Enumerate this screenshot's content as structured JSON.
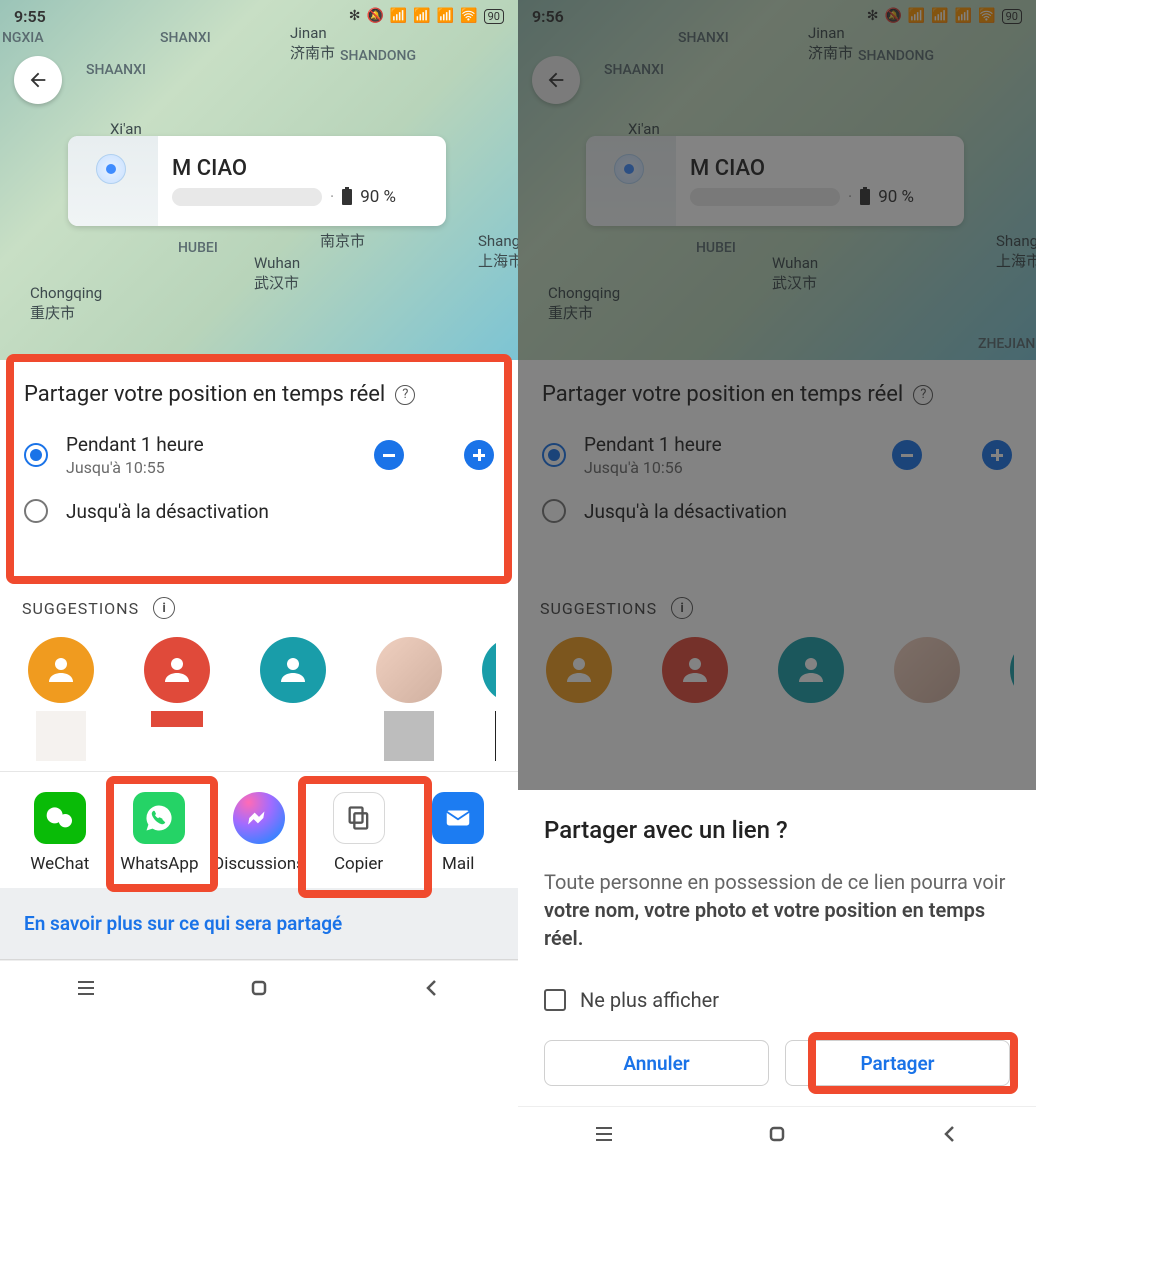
{
  "left": {
    "status_time": "9:55",
    "battery_status": "90",
    "user_name": "M CIAO",
    "battery_pct": "90 %",
    "share_title": "Partager votre position en temps réel",
    "option1_main": "Pendant 1 heure",
    "option1_sub": "Jusqu'à 10:55",
    "option2_main": "Jusqu'à la désactivation",
    "suggestions_label": "SUGGESTIONS",
    "apps": {
      "wechat": "WeChat",
      "whatsapp": "WhatsApp",
      "discussions": "Discussions",
      "copy": "Copier",
      "mail": "Mail"
    },
    "footer_link": "En savoir plus sur ce qui sera partagé"
  },
  "right": {
    "status_time": "9:56",
    "battery_status": "90",
    "user_name": "M CIAO",
    "battery_pct": "90 %",
    "share_title": "Partager votre position en temps réel",
    "option1_main": "Pendant 1 heure",
    "option1_sub": "Jusqu'à 10:56",
    "option2_main": "Jusqu'à la désactivation",
    "suggestions_label": "SUGGESTIONS",
    "dialog_title": "Partager avec un lien ?",
    "dialog_body_plain": "Toute personne en possession de ce lien pourra voir ",
    "dialog_body_bold": "votre nom, votre photo et votre position en temps réel.",
    "dont_show": "Ne plus afficher",
    "cancel": "Annuler",
    "share": "Partager"
  },
  "map_labels": {
    "ningxia": "NGXIA",
    "shanxi": "SHANXI",
    "shaanxi": "SHAANXI",
    "shandong": "SHANDONG",
    "hubei": "HUBEI",
    "zhejiang": "ZHEJIANG",
    "jinan": "Jinan\n济南市",
    "xian": "Xi'an\n西安市",
    "nanjing": "南京市",
    "shanghai": "Shanghai\n上海市",
    "wuhan": "Wuhan\n武汉市",
    "chongqing": "Chongqing\n重庆市"
  }
}
